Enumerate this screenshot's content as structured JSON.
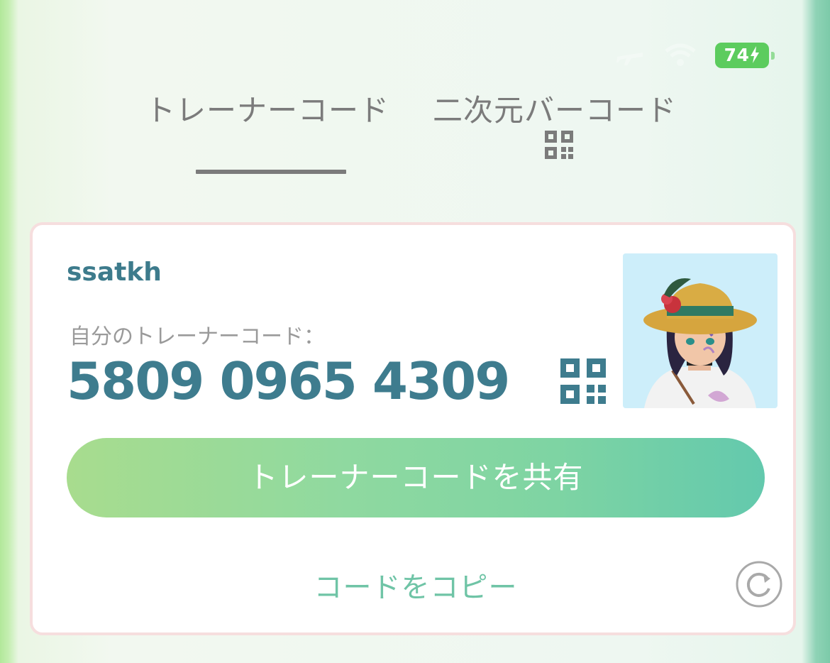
{
  "status_bar": {
    "battery_level": "74",
    "battery_charging": true,
    "battery_color": "#5ccc5e",
    "icons": [
      "airplane-icon",
      "wifi-icon",
      "battery-icon",
      "charging-bolt-icon"
    ]
  },
  "tabs": [
    {
      "label": "トレーナーコード",
      "active": true
    },
    {
      "label": "二次元バーコード",
      "active": false,
      "icon": "qr-code-icon"
    }
  ],
  "card": {
    "username": "ssatkh",
    "code_label": "自分のトレーナーコード：",
    "trainer_code": "5809 0965 4309",
    "qr_icon": "qr-code-icon",
    "avatar_icon": "trainer-avatar",
    "share_button_label": "トレーナーコードを共有",
    "copy_label": "コードをコピー",
    "refresh_icon": "refresh-icon"
  },
  "colors": {
    "accent_text": "#3e7c8e",
    "tab_text": "#7b7b7b",
    "share_gradient_start": "#a8dc8e",
    "share_gradient_end": "#63c9ad",
    "copy_text": "#6fc4a6",
    "card_border": "#f6dede"
  }
}
